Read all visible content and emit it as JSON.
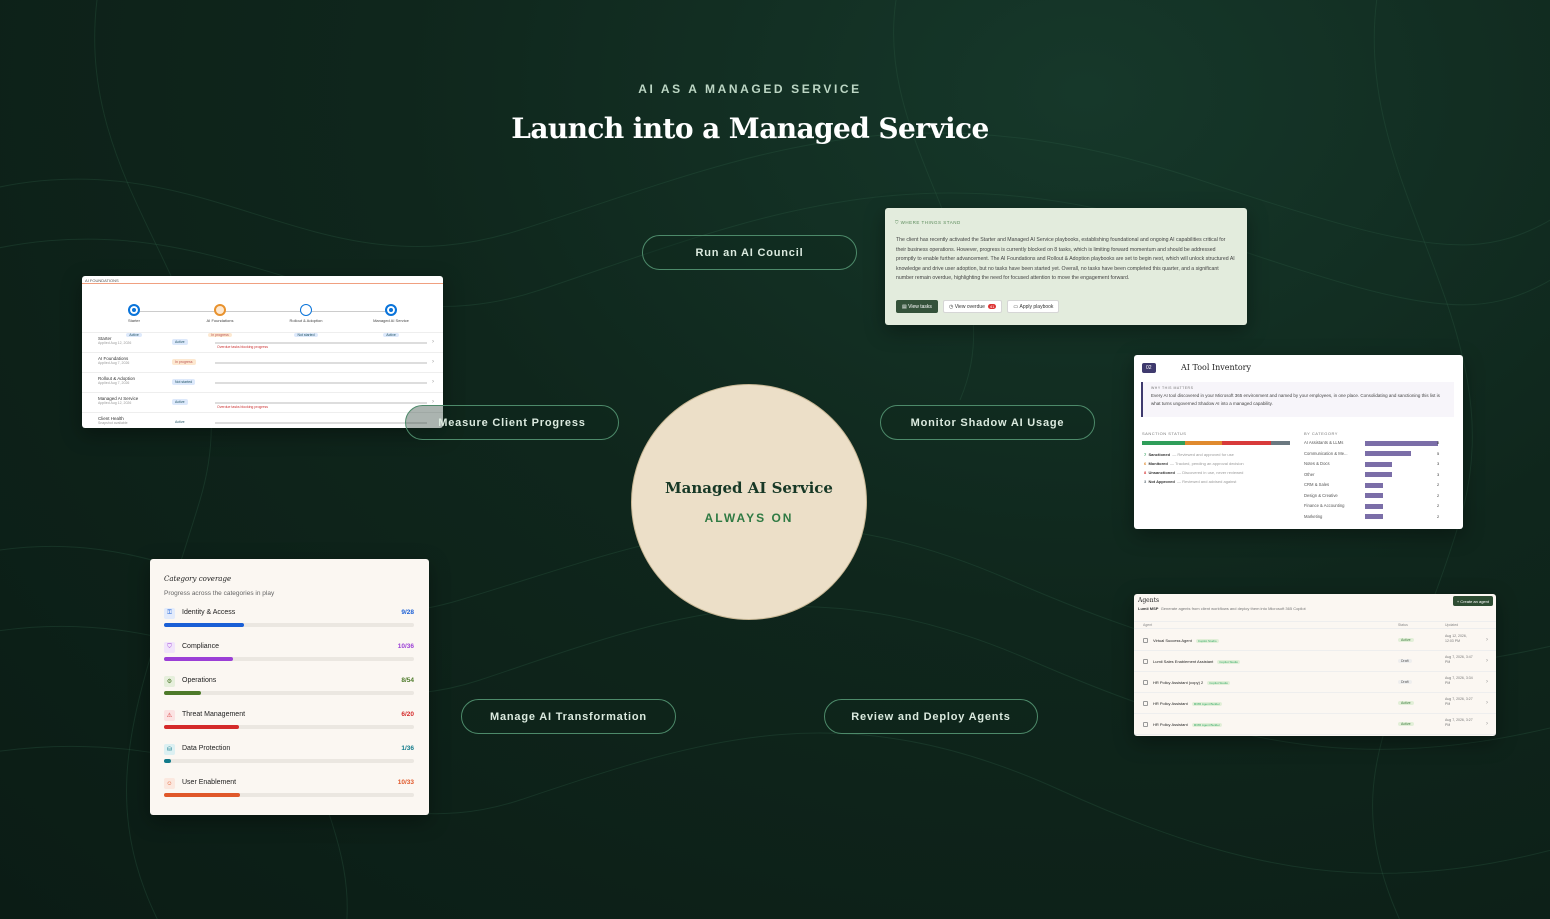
{
  "header": {
    "eyebrow": "AI AS A MANAGED SERVICE",
    "title": "Launch into a Managed Service"
  },
  "hub": {
    "title": "Managed AI Service",
    "subtitle": "ALWAYS ON"
  },
  "pills": {
    "council": "Run an AI Council",
    "progress": "Measure Client Progress",
    "shadow": "Monitor Shadow AI Usage",
    "transform": "Manage AI Transformation",
    "agents": "Review and Deploy Agents"
  },
  "progress_card": {
    "header": "AI FOUNDATIONS",
    "steps": [
      {
        "name": "Starter",
        "badge": "Active"
      },
      {
        "name": "AI Foundations",
        "badge": "In progress"
      },
      {
        "name": "Rollout & Adoption",
        "badge": "Not started"
      },
      {
        "name": "Managed AI Service",
        "badge": "Active"
      }
    ],
    "rows": [
      {
        "name": "Starter",
        "sub": "Applied Aug 12, 2026",
        "badge": "Active",
        "note": "Overdue tasks blocking progress"
      },
      {
        "name": "AI Foundations",
        "sub": "Applied Aug 7, 2026",
        "badge": "In progress",
        "note": ""
      },
      {
        "name": "Rollout & Adoption",
        "sub": "Applied Aug 7, 2026",
        "badge": "Not started",
        "note": ""
      },
      {
        "name": "Managed AI Service",
        "sub": "Applied Aug 12, 2026",
        "badge": "Active",
        "note": "Overdue tasks blocking progress"
      },
      {
        "name": "Client Health",
        "sub": "Snapshot available",
        "badge": "Active",
        "note": ""
      }
    ]
  },
  "status_card": {
    "label": "WHERE THINGS STAND",
    "body": "The client has recently activated the Starter and Managed AI Service playbooks, establishing foundational and ongoing AI capabilities critical for their business operations. However, progress is currently blocked on 8 tasks, which is limiting forward momentum and should be addressed promptly to enable further advancement. The AI Foundations and Rollout & Adoption playbooks are set to begin next, which will unlock structured AI knowledge and drive user adoption, but no tasks have been started yet. Overall, no tasks have been completed this quarter, and a significant number remain overdue, highlighting the need for focused attention to move the engagement forward.",
    "btn_tasks": "View tasks",
    "btn_overdue": "View overdue",
    "overdue_count": "41",
    "btn_playbook": "Apply playbook"
  },
  "inventory_card": {
    "number": "02",
    "title": "AI Tool Inventory",
    "why_label": "WHY THIS MATTERS",
    "why_text": "Every AI tool discovered in your Microsoft 365 environment and named by your employees, in one place. Consolidating and sanctioning this list is what turns ungoverned Shadow AI into a managed capability.",
    "status_label": "SANCTION STATUS",
    "legend": [
      {
        "count": "7",
        "name": "Sanctioned",
        "desc": "— Reviewed and approved for use",
        "color": "#2f9e5a"
      },
      {
        "count": "6",
        "name": "Monitored",
        "desc": "— Tracked, pending an approval decision",
        "color": "#e08a2e"
      },
      {
        "count": "8",
        "name": "Unsanctioned",
        "desc": "— Discovered in use, never reviewed",
        "color": "#d83a3a"
      },
      {
        "count": "3",
        "name": "Not Approved",
        "desc": "— Reviewed and advised against",
        "color": "#6b7880"
      }
    ],
    "category_label": "BY CATEGORY",
    "categories": [
      {
        "name": "AI Assistants & LLMs",
        "value": 8
      },
      {
        "name": "Communication & Me...",
        "value": 5
      },
      {
        "name": "Notes & Docs",
        "value": 3
      },
      {
        "name": "Other",
        "value": 3
      },
      {
        "name": "CRM & Sales",
        "value": 2
      },
      {
        "name": "Design & Creative",
        "value": 2
      },
      {
        "name": "Finance & Accounting",
        "value": 2
      },
      {
        "name": "Marketing",
        "value": 2
      }
    ]
  },
  "coverage_card": {
    "title": "Category coverage",
    "subtitle": "Progress across the categories in play",
    "items": [
      {
        "name": "Identity & Access",
        "value": "9/28",
        "done": 9,
        "total": 28,
        "color": "#1a5fd6",
        "bg": "#e3ebfb",
        "icon": "lock-icon",
        "glyph": "⚿"
      },
      {
        "name": "Compliance",
        "value": "10/36",
        "done": 10,
        "total": 36,
        "color": "#9b3fd6",
        "bg": "#f1e4fb",
        "icon": "shield-icon",
        "glyph": "⛉"
      },
      {
        "name": "Operations",
        "value": "8/54",
        "done": 8,
        "total": 54,
        "color": "#4d7a2a",
        "bg": "#e6efdc",
        "icon": "gear-icon",
        "glyph": "⚙"
      },
      {
        "name": "Threat Management",
        "value": "6/20",
        "done": 6,
        "total": 20,
        "color": "#d42a2a",
        "bg": "#fbe3e3",
        "icon": "warning-icon",
        "glyph": "⚠"
      },
      {
        "name": "Data Protection",
        "value": "1/36",
        "done": 1,
        "total": 36,
        "color": "#117a8a",
        "bg": "#dcf0f2",
        "icon": "database-icon",
        "glyph": "⛁"
      },
      {
        "name": "User Enablement",
        "value": "10/33",
        "done": 10,
        "total": 33,
        "color": "#e0582a",
        "bg": "#fbe8df",
        "icon": "users-icon",
        "glyph": "☺"
      }
    ]
  },
  "agents_card": {
    "title": "Agents",
    "org": "Lumii MSP",
    "desc": "Generate agents from client workflows and deploy them into Microsoft 365 Copilot",
    "create": "+ Create an agent",
    "col_agent": "Agent",
    "col_status": "Status",
    "col_updated": "Updated",
    "rows": [
      {
        "name": "Virtual Success Agent",
        "tag": "Copilot Studio",
        "status": "Active",
        "date": "Aug 12, 2026, 12:03 PM"
      },
      {
        "name": "Lumii Sales Enablement Assistant",
        "tag": "Copilot Studio",
        "status": "Draft",
        "date": "Aug 7, 2026, 3:47 PM"
      },
      {
        "name": "HR Policy Assistant (copy) 2",
        "tag": "Copilot Studio",
        "status": "Draft",
        "date": "Aug 7, 2026, 3:34 PM"
      },
      {
        "name": "HR Policy Assistant",
        "tag": "M365 Agent Builder",
        "status": "Active",
        "date": "Aug 7, 2026, 3:27 PM"
      },
      {
        "name": "HR Policy Assistant",
        "tag": "M365 Agent Builder",
        "status": "Active",
        "date": "Aug 7, 2026, 3:27 PM"
      }
    ]
  }
}
